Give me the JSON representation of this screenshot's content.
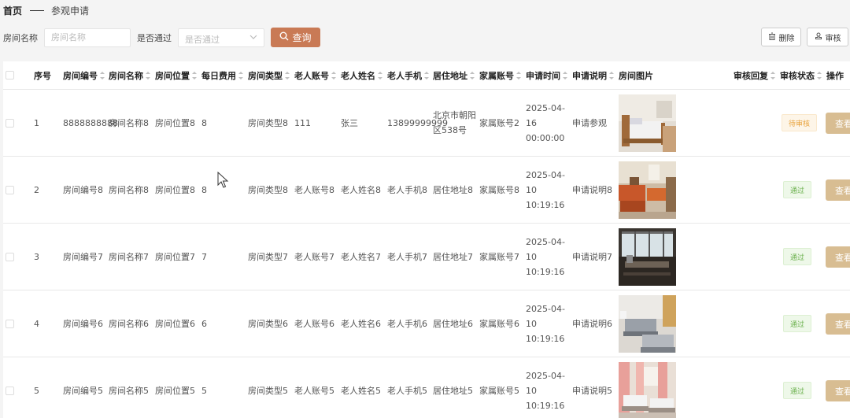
{
  "breadcrumb": {
    "home": "首页",
    "current": "参观申请"
  },
  "filters": {
    "room_name_label": "房间名称",
    "room_name_placeholder": "房间名称",
    "pass_label": "是否通过",
    "pass_placeholder": "是否通过",
    "query_label": "查询"
  },
  "actions": {
    "delete_label": "删除",
    "audit_label": "审核"
  },
  "colors": {
    "accent": "#c97a55",
    "view_button": "#d8bd92",
    "pending": "#e8a13a",
    "pass": "#6ab04c"
  },
  "table": {
    "headers": {
      "index": "序号",
      "room_no": "房间编号",
      "room_name": "房间名称",
      "room_location": "房间位置",
      "daily_fee": "每日费用",
      "room_type": "房间类型",
      "elder_account": "老人账号",
      "elder_name": "老人姓名",
      "elder_phone": "老人手机",
      "address": "居住地址",
      "family_account": "家属账号",
      "apply_time": "申请时间",
      "apply_note": "申请说明",
      "room_image": "房间图片",
      "audit_reply": "审核回复",
      "audit_status": "审核状态",
      "operation": "操作"
    },
    "view_label": "查看",
    "rows": [
      {
        "index": "1",
        "room_no": "8888888888",
        "room_name": "房间名称8",
        "room_location": "房间位置8",
        "daily_fee": "8",
        "room_type": "房间类型8",
        "elder_account": "111",
        "elder_name": "张三",
        "elder_phone": "13899999999",
        "address": "北京市朝阳区538号",
        "family_account": "家属账号2",
        "apply_time": "2025-04-16 00:00:00",
        "apply_note": "申请参观",
        "audit_reply": "",
        "audit_status": "待审核",
        "status_kind": "pending",
        "image": "bedroom-wood-bed"
      },
      {
        "index": "2",
        "room_no": "房间编号8",
        "room_name": "房间名称8",
        "room_location": "房间位置8",
        "daily_fee": "8",
        "room_type": "房间类型8",
        "elder_account": "老人账号8",
        "elder_name": "老人姓名8",
        "elder_phone": "老人手机8",
        "address": "居住地址8",
        "family_account": "家属账号8",
        "apply_time": "2025-04-10 10:19:16",
        "apply_note": "申请说明8",
        "audit_reply": "",
        "audit_status": "通过",
        "status_kind": "pass",
        "image": "ward-orange-beds"
      },
      {
        "index": "3",
        "room_no": "房间编号7",
        "room_name": "房间名称7",
        "room_location": "房间位置7",
        "daily_fee": "7",
        "room_type": "房间类型7",
        "elder_account": "老人账号7",
        "elder_name": "老人姓名7",
        "elder_phone": "老人手机7",
        "address": "居住地址7",
        "family_account": "家属账号7",
        "apply_time": "2025-04-10 10:19:16",
        "apply_note": "申请说明7",
        "audit_reply": "",
        "audit_status": "通过",
        "status_kind": "pass",
        "image": "dining-hall-windows"
      },
      {
        "index": "4",
        "room_no": "房间编号6",
        "room_name": "房间名称6",
        "room_location": "房间位置6",
        "daily_fee": "6",
        "room_type": "房间类型6",
        "elder_account": "老人账号6",
        "elder_name": "老人姓名6",
        "elder_phone": "老人手机6",
        "address": "居住地址6",
        "family_account": "家属账号6",
        "apply_time": "2025-04-10 10:19:16",
        "apply_note": "申请说明6",
        "audit_reply": "",
        "audit_status": "通过",
        "status_kind": "pass",
        "image": "ward-grey-beds"
      },
      {
        "index": "5",
        "room_no": "房间编号5",
        "room_name": "房间名称5",
        "room_location": "房间位置5",
        "daily_fee": "5",
        "room_type": "房间类型5",
        "elder_account": "老人账号5",
        "elder_name": "老人姓名5",
        "elder_phone": "老人手机5",
        "address": "居住地址5",
        "family_account": "家属账号5",
        "apply_time": "2025-04-10 10:19:16",
        "apply_note": "申请说明5",
        "audit_reply": "",
        "audit_status": "通过",
        "status_kind": "pass",
        "image": "ward-pink-curtains"
      }
    ]
  }
}
